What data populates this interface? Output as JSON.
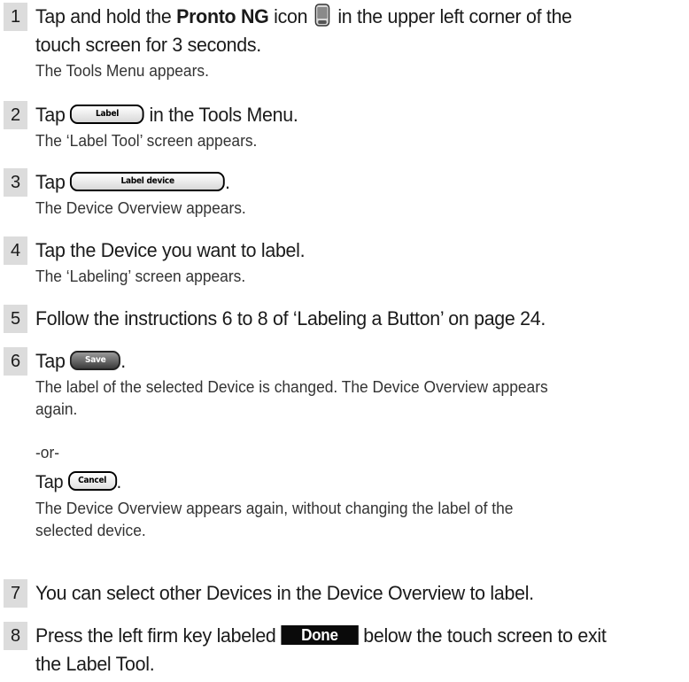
{
  "steps": [
    {
      "num": "1",
      "pre": "Tap and hold the ",
      "bold": "Pronto NG",
      "mid": " icon ",
      "post": " in the upper left corner of the",
      "line2": "touch screen for 3 seconds.",
      "result": "The Tools Menu appears.",
      "icon": "pronto-ng-device-icon"
    },
    {
      "num": "2",
      "pre": "Tap ",
      "button": "Label",
      "post": " in the Tools Menu.",
      "result": "The ‘Label Tool’ screen appears."
    },
    {
      "num": "3",
      "pre": "Tap ",
      "button": "Label device",
      "post": ".",
      "result": "The Device Overview appears."
    },
    {
      "num": "4",
      "text": "Tap the Device you want to label.",
      "result": "The ‘Labeling’ screen appears."
    },
    {
      "num": "5",
      "text": "Follow the instructions 6 to 8 of ‘Labeling a Button’ on page 24."
    },
    {
      "num": "6",
      "pre": "Tap ",
      "button": "Save",
      "post": ".",
      "result": "The label of the selected Device is changed. The Device Overview appears",
      "result2": "again.",
      "or": "-or-",
      "alt_pre": "Tap ",
      "alt_button": "Cancel",
      "alt_post": ".",
      "alt_result": "The Device Overview appears again, without changing the label of the",
      "alt_result2": "selected device."
    },
    {
      "num": "7",
      "text": "You can select other Devices in the Device Overview to label."
    },
    {
      "num": "8",
      "pre": "Press the left firm key labeled ",
      "key": "Done",
      "post": " below the touch screen to exit",
      "line2": "the Label Tool."
    }
  ],
  "colors": {
    "number_box": "#dcdcdc",
    "done_key": "#0a0a0a"
  }
}
